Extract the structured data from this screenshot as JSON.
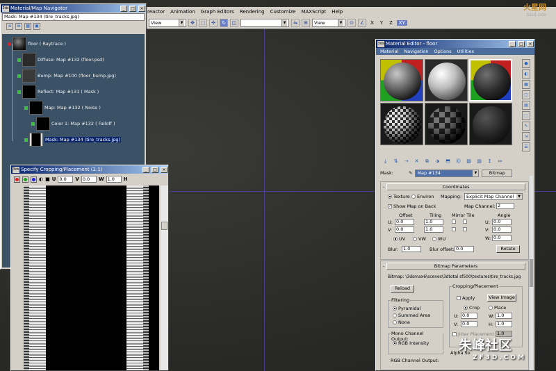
{
  "menubar": {
    "items": [
      "reactor",
      "Animation",
      "Graph Editors",
      "Rendering",
      "Customize",
      "MAXScript",
      "Help"
    ]
  },
  "toolbar": {
    "view1": "View",
    "view2": "View",
    "axes": [
      "X",
      "Y",
      "Z",
      "XY"
    ]
  },
  "logo": {
    "brand": "火星网",
    "sub": "hxsd.com"
  },
  "navigator": {
    "title": "Material/Map Navigator",
    "selected": "Mask: Map #134 (tire_tracks.jpg)",
    "nodes": [
      {
        "label": "floor  ( Raytrace )"
      },
      {
        "label": "Diffuse: Map #132 (floor.psd)"
      },
      {
        "label": "Bump: Map #100 (floor_bump.jpg)"
      },
      {
        "label": "Reflect: Map #131  ( Mask )"
      },
      {
        "label": "Map: Map #132  ( Noise )"
      },
      {
        "label": "Color 1: Map #132  ( Falloff )"
      },
      {
        "label": "Mask: Map #134 (tire_tracks.jpg)"
      }
    ]
  },
  "crop": {
    "title": "Specify Cropping/Placement (1:1)",
    "u_label": "U",
    "u": "0.0",
    "v_label": "V",
    "v": "0.0",
    "w_label": "W",
    "w": "1.0",
    "h_label": "H"
  },
  "mated": {
    "title": "Material Editor - floor",
    "menu": [
      "Material",
      "Navigation",
      "Options",
      "Utilities"
    ],
    "mask_label": "Mask:",
    "mask_value": "Map #134",
    "bitmap_btn": "Bitmap",
    "coords": {
      "header": "Coordinates",
      "texture": "Texture",
      "environ": "Environ",
      "mapping_label": "Mapping:",
      "mapping": "Explicit Map Channel",
      "show_map": "Show Map on Back",
      "map_channel_label": "Map Channel:",
      "map_channel": "2",
      "offset": "Offset",
      "tiling": "Tiling",
      "mirror_tile": "Mirror Tile",
      "angle": "Angle",
      "u_label": "U:",
      "v_label": "V:",
      "w_label": "W:",
      "u_offset": "0.0",
      "v_offset": "0.0",
      "u_tiling": "1.0",
      "v_tiling": "1.0",
      "angle_u": "0.0",
      "angle_v": "0.0",
      "angle_w": "0.0",
      "uv": "UV",
      "vw": "VW",
      "wu": "WU",
      "blur_label": "Blur:",
      "blur": "1.0",
      "blur_offset_label": "Blur offset:",
      "blur_offset": "0.0",
      "rotate": "Rotate"
    },
    "bitmap": {
      "header": "Bitmap Parameters",
      "path": "Bitmap: \\3dsmax6\\scenes\\3dtotal sf500\\textures\\tire_tracks.jpg",
      "reload": "Reload",
      "filtering": "Filtering",
      "pyramidal": "Pyramidal",
      "summed": "Summed Area",
      "none": "None",
      "mono": "Mono Channel Output:",
      "rgb_int": "RGB Intensity",
      "rgb_out": "RGB Channel Output:",
      "crop_place": "Cropping/Placement",
      "apply": "Apply",
      "view_image": "View Image",
      "crop": "Crop",
      "place": "Place",
      "u": "0.0",
      "v": "0.0",
      "w": "1.0",
      "h": "1.0",
      "jitter": "Jitter Placement",
      "jitter_val": "1.0",
      "alpha": "Alpha So"
    }
  },
  "watermark": {
    "cn": "朱峰社区",
    "en": "ZF3D.COM"
  }
}
